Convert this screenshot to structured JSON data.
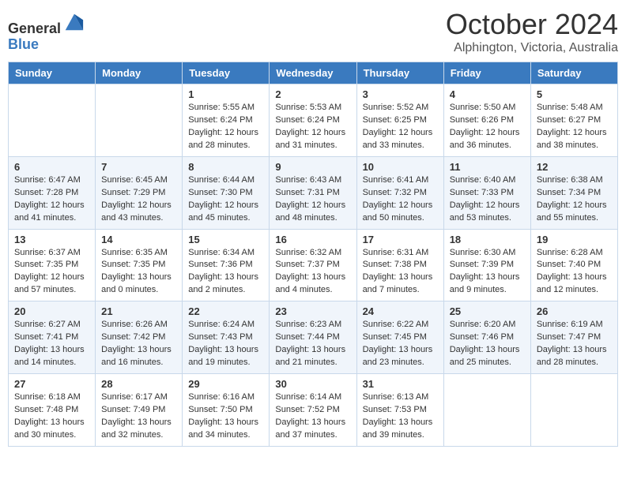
{
  "header": {
    "logo_line1": "General",
    "logo_line2": "Blue",
    "month_title": "October 2024",
    "subtitle": "Alphington, Victoria, Australia"
  },
  "days_of_week": [
    "Sunday",
    "Monday",
    "Tuesday",
    "Wednesday",
    "Thursday",
    "Friday",
    "Saturday"
  ],
  "weeks": [
    [
      {
        "day": "",
        "info": ""
      },
      {
        "day": "",
        "info": ""
      },
      {
        "day": "1",
        "info": "Sunrise: 5:55 AM\nSunset: 6:24 PM\nDaylight: 12 hours and 28 minutes."
      },
      {
        "day": "2",
        "info": "Sunrise: 5:53 AM\nSunset: 6:24 PM\nDaylight: 12 hours and 31 minutes."
      },
      {
        "day": "3",
        "info": "Sunrise: 5:52 AM\nSunset: 6:25 PM\nDaylight: 12 hours and 33 minutes."
      },
      {
        "day": "4",
        "info": "Sunrise: 5:50 AM\nSunset: 6:26 PM\nDaylight: 12 hours and 36 minutes."
      },
      {
        "day": "5",
        "info": "Sunrise: 5:48 AM\nSunset: 6:27 PM\nDaylight: 12 hours and 38 minutes."
      }
    ],
    [
      {
        "day": "6",
        "info": "Sunrise: 6:47 AM\nSunset: 7:28 PM\nDaylight: 12 hours and 41 minutes."
      },
      {
        "day": "7",
        "info": "Sunrise: 6:45 AM\nSunset: 7:29 PM\nDaylight: 12 hours and 43 minutes."
      },
      {
        "day": "8",
        "info": "Sunrise: 6:44 AM\nSunset: 7:30 PM\nDaylight: 12 hours and 45 minutes."
      },
      {
        "day": "9",
        "info": "Sunrise: 6:43 AM\nSunset: 7:31 PM\nDaylight: 12 hours and 48 minutes."
      },
      {
        "day": "10",
        "info": "Sunrise: 6:41 AM\nSunset: 7:32 PM\nDaylight: 12 hours and 50 minutes."
      },
      {
        "day": "11",
        "info": "Sunrise: 6:40 AM\nSunset: 7:33 PM\nDaylight: 12 hours and 53 minutes."
      },
      {
        "day": "12",
        "info": "Sunrise: 6:38 AM\nSunset: 7:34 PM\nDaylight: 12 hours and 55 minutes."
      }
    ],
    [
      {
        "day": "13",
        "info": "Sunrise: 6:37 AM\nSunset: 7:35 PM\nDaylight: 12 hours and 57 minutes."
      },
      {
        "day": "14",
        "info": "Sunrise: 6:35 AM\nSunset: 7:35 PM\nDaylight: 13 hours and 0 minutes."
      },
      {
        "day": "15",
        "info": "Sunrise: 6:34 AM\nSunset: 7:36 PM\nDaylight: 13 hours and 2 minutes."
      },
      {
        "day": "16",
        "info": "Sunrise: 6:32 AM\nSunset: 7:37 PM\nDaylight: 13 hours and 4 minutes."
      },
      {
        "day": "17",
        "info": "Sunrise: 6:31 AM\nSunset: 7:38 PM\nDaylight: 13 hours and 7 minutes."
      },
      {
        "day": "18",
        "info": "Sunrise: 6:30 AM\nSunset: 7:39 PM\nDaylight: 13 hours and 9 minutes."
      },
      {
        "day": "19",
        "info": "Sunrise: 6:28 AM\nSunset: 7:40 PM\nDaylight: 13 hours and 12 minutes."
      }
    ],
    [
      {
        "day": "20",
        "info": "Sunrise: 6:27 AM\nSunset: 7:41 PM\nDaylight: 13 hours and 14 minutes."
      },
      {
        "day": "21",
        "info": "Sunrise: 6:26 AM\nSunset: 7:42 PM\nDaylight: 13 hours and 16 minutes."
      },
      {
        "day": "22",
        "info": "Sunrise: 6:24 AM\nSunset: 7:43 PM\nDaylight: 13 hours and 19 minutes."
      },
      {
        "day": "23",
        "info": "Sunrise: 6:23 AM\nSunset: 7:44 PM\nDaylight: 13 hours and 21 minutes."
      },
      {
        "day": "24",
        "info": "Sunrise: 6:22 AM\nSunset: 7:45 PM\nDaylight: 13 hours and 23 minutes."
      },
      {
        "day": "25",
        "info": "Sunrise: 6:20 AM\nSunset: 7:46 PM\nDaylight: 13 hours and 25 minutes."
      },
      {
        "day": "26",
        "info": "Sunrise: 6:19 AM\nSunset: 7:47 PM\nDaylight: 13 hours and 28 minutes."
      }
    ],
    [
      {
        "day": "27",
        "info": "Sunrise: 6:18 AM\nSunset: 7:48 PM\nDaylight: 13 hours and 30 minutes."
      },
      {
        "day": "28",
        "info": "Sunrise: 6:17 AM\nSunset: 7:49 PM\nDaylight: 13 hours and 32 minutes."
      },
      {
        "day": "29",
        "info": "Sunrise: 6:16 AM\nSunset: 7:50 PM\nDaylight: 13 hours and 34 minutes."
      },
      {
        "day": "30",
        "info": "Sunrise: 6:14 AM\nSunset: 7:52 PM\nDaylight: 13 hours and 37 minutes."
      },
      {
        "day": "31",
        "info": "Sunrise: 6:13 AM\nSunset: 7:53 PM\nDaylight: 13 hours and 39 minutes."
      },
      {
        "day": "",
        "info": ""
      },
      {
        "day": "",
        "info": ""
      }
    ]
  ]
}
